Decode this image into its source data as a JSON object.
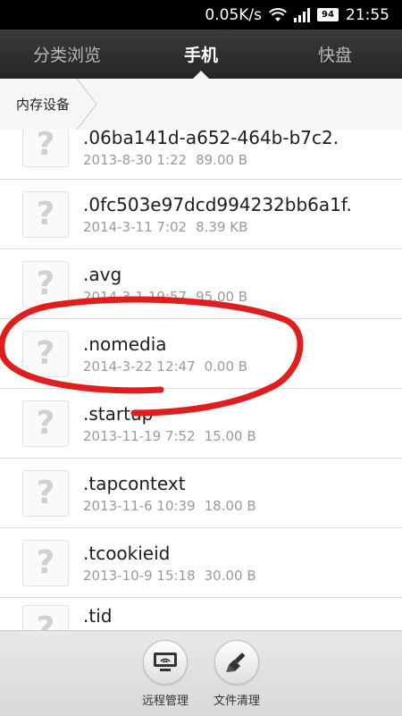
{
  "status_bar": {
    "speed": "0.05K/s",
    "battery": "94",
    "time": "21:55",
    "icons": [
      "wifi-icon",
      "signal-icon",
      "battery-icon"
    ]
  },
  "tabs": [
    {
      "label": "分类浏览",
      "active": false
    },
    {
      "label": "手机",
      "active": true
    },
    {
      "label": "快盘",
      "active": false
    }
  ],
  "breadcrumb": {
    "label": "内存设备"
  },
  "files": [
    {
      "name": ".06ba141d-a652-464b-b7c2.",
      "date": "2013-8-30 1:22",
      "size": "89.00 B"
    },
    {
      "name": ".0fc503e97dcd994232bb6a1f.",
      "date": "2014-3-11 7:02",
      "size": "8.39 KB"
    },
    {
      "name": ".avg",
      "date": "2014-3-1 19:57",
      "size": "95.00 B"
    },
    {
      "name": ".nomedia",
      "date": "2014-3-22 12:47",
      "size": "0.00 B"
    },
    {
      "name": ".startup",
      "date": "2013-11-19 7:52",
      "size": "15.00 B"
    },
    {
      "name": ".tapcontext",
      "date": "2013-11-6 10:39",
      "size": "18.00 B"
    },
    {
      "name": ".tcookieid",
      "date": "2013-10-9 15:18",
      "size": "30.00 B"
    },
    {
      "name": ".tid",
      "date": "",
      "size": ""
    }
  ],
  "file_icon_glyph": "?",
  "bottom_actions": [
    {
      "label": "远程管理",
      "icon": "monitor-icon"
    },
    {
      "label": "文件清理",
      "icon": "broom-icon"
    }
  ],
  "colors": {
    "annotation": "#e01e1e",
    "tab_bar": "#2e2e2e"
  }
}
